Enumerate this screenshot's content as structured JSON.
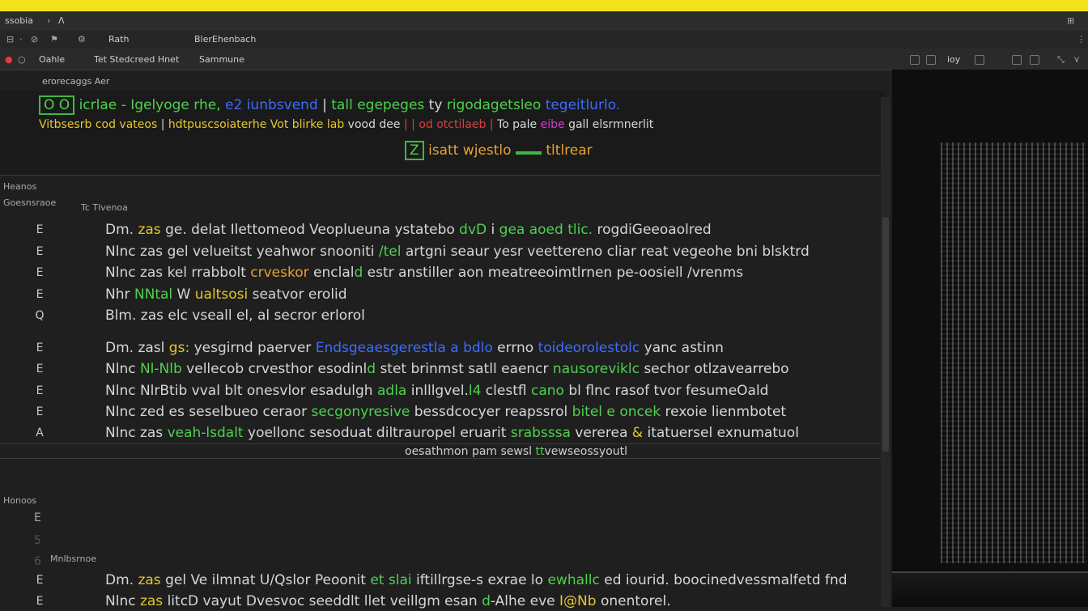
{
  "colors": {
    "accent_yellow": "#f3e21b",
    "green": "#4fd14f",
    "blue": "#3d6cff",
    "red": "#e03d3d",
    "orange": "#e8a22e",
    "magenta": "#d23fd2"
  },
  "titlebar": {
    "left": "ssobia",
    "title": "Rath",
    "doc": "BlerEhenbach"
  },
  "menubar": {
    "item1": "Oahle",
    "item2": "Tet Stedcreed Hnet",
    "item3": "Sammune"
  },
  "toolbar": {
    "right": "ioy"
  },
  "breadcrumb": "erorecaggs Aer",
  "header": {
    "line1_a": "O O ",
    "line1_b": "icrlae - ",
    "line1_c": "Igelyoge rhe, ",
    "line1_d": "e2 iunbsvend",
    "line1_e": " | ",
    "line1_f": "tall egepeges",
    "line1_g": " ty ",
    "line1_h": "rigodagetsleo",
    "line1_i": " tegeitlurlo.",
    "line2_a": "Vitbsesrb cod vateos",
    "line2_b": " | ",
    "line2_c": "hdtpuscsoiaterhe Vot blirke lab",
    "line2_d": " vood dee",
    "line2_e": " | | ",
    "line2_f": "od otctilaeb",
    "line2_g": " | ",
    "line2_h": "To pale",
    "line2_i": " eibe ",
    "line2_j": " gall elsrmnerlit",
    "line3_a": "Z",
    "line3_b": " isatt wjestlo ",
    "line3_c": " ",
    "line3_d": "tltlrear"
  },
  "section1": {
    "title": "Heanos",
    "subtitle": "Goesnsraoe",
    "subtitle2": "Tc Tlvenoa"
  },
  "rows1": [
    {
      "icon": "E",
      "p1": "Dm. ",
      "p2": "zas ",
      "p3": "ge. delat Ilettomeod Veoplueuna ",
      "p4": "ystatebo ",
      "p5": "dvD ",
      "p6": "i ",
      "p7": "gea aoed tlic.",
      "p8": " rogdiGeeoaolred"
    },
    {
      "icon": "E",
      "p1": "Nlnc ",
      "p2": "zas ",
      "p3": "gel velueitst yeahwor snooniti",
      "p4": " /tel",
      "p5": " artgni seaur yesr veettereno cliar",
      "p6": "",
      "p7": "",
      "p8": " reat vegeohe bni blsktrd"
    },
    {
      "icon": "E",
      "p1": "Nlnc ",
      "p2": "zas ",
      "p3": "kel rrabbolt ",
      "p4": "crveskor",
      "p5": " enclal",
      "p6": "d",
      "p7": " estr anstiller aon meatreeoimtlrnen",
      "p8": " pe-oosiell /vrenms"
    },
    {
      "icon": "E",
      "p1": "Nhr ",
      "p2": "NNtal",
      "p3": " W ",
      "p4": "ualtsosi",
      "p5": " seatvor ",
      "p6": "erolid",
      "p7": "",
      "p8": ""
    },
    {
      "icon": "Q",
      "p1": "Blm. ",
      "p2": "zas ",
      "p3": "elc vseall el, al",
      "p4": " secror",
      "p5": " erlorol",
      "p6": "",
      "p7": "",
      "p8": ""
    }
  ],
  "rows2": [
    {
      "icon": "E",
      "p1": "Dm. ",
      "p2": "zasl ",
      "p3": "gs: ",
      "p4": "yesgirnd paerver ",
      "p5": "Endsgeaesgerestla a bdlo",
      "p6": " errno ",
      "p7": "toideorolestolc",
      "p8": " yanc astinn"
    },
    {
      "icon": "E",
      "p1": "Nlnc ",
      "p2": "Nl-Nlb",
      "p3": " vellecob ",
      "p4": "crvesthor esodinl",
      "p5": "d ",
      "p6": "stet",
      "p7": " brinmst satll eaencr ",
      "p8": "nausoreviklc",
      "p9": " sechor otlzavearrebo"
    },
    {
      "icon": "E",
      "p1": "Nlnc ",
      "p2": "NlrBtib ",
      "p3": "vval blt ",
      "p4": "onesvlor ",
      "p5": "esadulgh ",
      "p6": "adla ",
      "p7": "inlllgvel.",
      "p8": "l4",
      "p9": " clestfl ",
      "p10": "cano ",
      "p11": "bl flnc",
      "p12": " rasof tvor fesumeOald"
    },
    {
      "icon": "E",
      "p1": "Nlnc ",
      "p2": "zed ",
      "p3": "es ",
      "p4": "seselbueo ",
      "p5": "ceraor ",
      "p6": "secgonyresive",
      "p7": " bessdcocyer reapssrol",
      "p8": " bitel e ",
      "p9": "oncek",
      "p10": " rexoie lienmbotet"
    },
    {
      "icon": "A",
      "p1": "Nlnc ",
      "p2": "zas ",
      "p3": "veah-lsdalt",
      "p4": " yoellonc",
      "p5": " sesoduat diltrauropel",
      "p6": " eruarit ",
      "p7": "srabsssa",
      "p8": " vererea ",
      "p9": "&",
      "p10": " itatuersel",
      "p11": " exnumatuol"
    }
  ],
  "footer_note": {
    "a": "oesathmon pam ",
    "b": "sewsl",
    "c": " t",
    "d": "t",
    "e": "vewseossyoutl"
  },
  "section2": {
    "title": "Honoos",
    "subtitle": "Mnlbsrnoe"
  },
  "rows3": [
    {
      "icon": "E",
      "p1": "Dm. ",
      "p2": "zas ",
      "p3": "gel ",
      "p4": "Ve ilmnat ",
      "p5": "U/Qslor Peoonit",
      "p6": " et ",
      "p7": "slai",
      "p8": " iftillrgse-s ",
      "p9": "exrae lo ",
      "p10": "ewhallc",
      "p11": " ed iourid. ",
      "p12": "boocinedvessmalfetd fnd"
    },
    {
      "icon": "E",
      "p1": "Nlnc ",
      "p2": "zas ",
      "p3": "litcD vayut ",
      "p4": "Dvesvoc",
      "p5": " seeddlt llet veillgm esan ",
      "p6": "d",
      "p7": "-Alhe eve ",
      "p8": "I@Nb",
      "p9": " onentorel."
    }
  ]
}
